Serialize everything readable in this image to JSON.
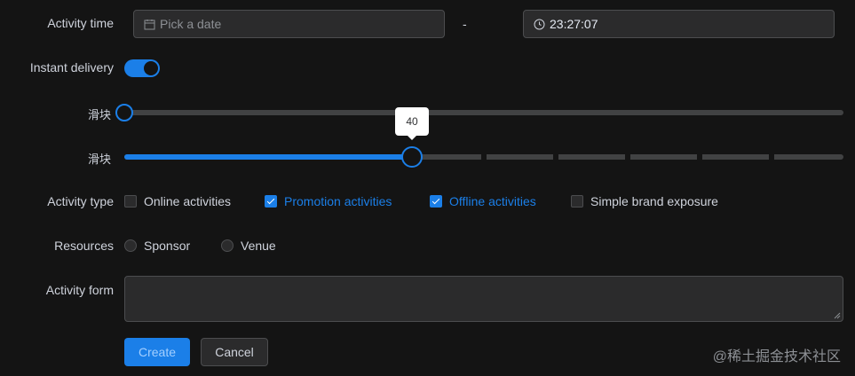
{
  "form": {
    "activity_time": {
      "label": "Activity time",
      "date_placeholder": "Pick a date",
      "separator": "-",
      "time_value": "23:27:07"
    },
    "instant_delivery": {
      "label": "Instant delivery",
      "enabled": true
    },
    "sliders": [
      {
        "label": "滑块",
        "value": 0
      },
      {
        "label": "滑块",
        "value": 40,
        "tooltip": "40"
      }
    ],
    "activity_type": {
      "label": "Activity type",
      "options": [
        {
          "label": "Online activities",
          "checked": false
        },
        {
          "label": "Promotion activities",
          "checked": true
        },
        {
          "label": "Offline activities",
          "checked": true
        },
        {
          "label": "Simple brand exposure",
          "checked": false
        }
      ]
    },
    "resources": {
      "label": "Resources",
      "options": [
        {
          "label": "Sponsor",
          "selected": false
        },
        {
          "label": "Venue",
          "selected": false
        }
      ]
    },
    "activity_form": {
      "label": "Activity form",
      "value": ""
    },
    "buttons": {
      "create": "Create",
      "cancel": "Cancel"
    }
  },
  "watermark": "@稀土掘金技术社区",
  "colors": {
    "background": "#141414",
    "accent": "#1b7fe8",
    "input_bg": "#2b2b2c",
    "border": "#4c4d4f"
  }
}
